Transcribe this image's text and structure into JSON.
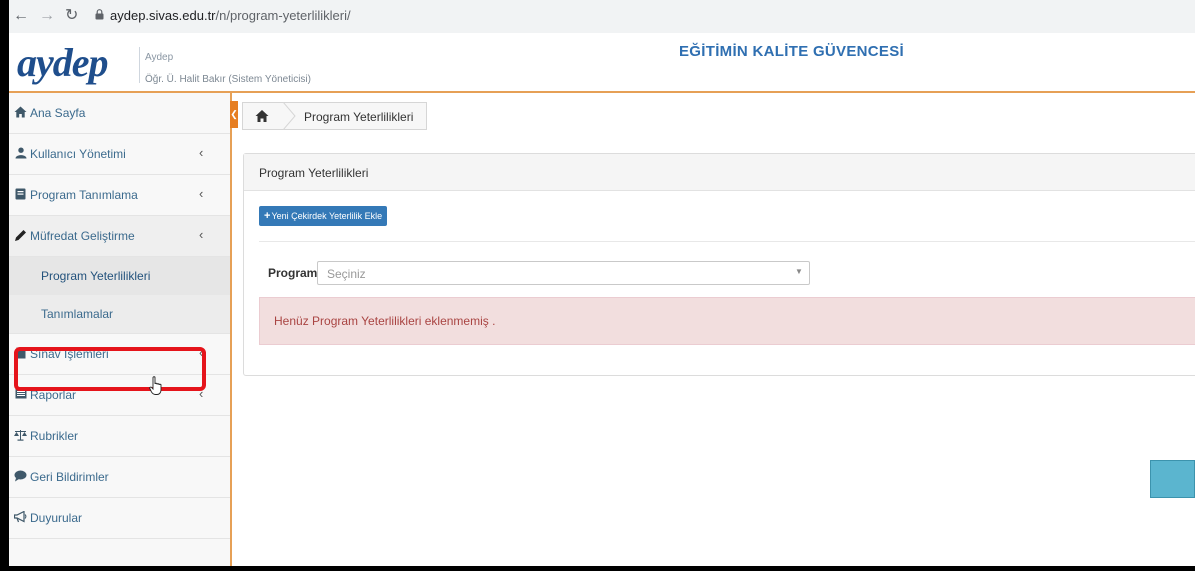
{
  "browser": {
    "url_host": "aydep.sivas.edu.tr",
    "url_path": "/n/program-yeterlilikleri/"
  },
  "header": {
    "logo_text": "aydep",
    "app_name": "Aydep",
    "user": "Öğr. Ü. Halit Bakır (Sistem Yöneticisi)",
    "slogan": "EĞİTİMİN KALİTE GÜVENCESİ"
  },
  "sidebar": {
    "items": [
      {
        "label": "Ana Sayfa",
        "icon": "home-icon"
      },
      {
        "label": "Kullanıcı Yönetimi",
        "icon": "user-icon",
        "chevron": "‹"
      },
      {
        "label": "Program Tanımlama",
        "icon": "book-icon",
        "chevron": "‹"
      },
      {
        "label": "Müfredat Geliştirme",
        "icon": "pencil-icon",
        "chevron": "‹"
      },
      {
        "label": "Sınav İşlemleri",
        "icon": "file-icon",
        "chevron": "‹"
      },
      {
        "label": "Raporlar",
        "icon": "list-icon",
        "chevron": "‹"
      },
      {
        "label": "Rubrikler",
        "icon": "balance-scale-icon"
      },
      {
        "label": "Geri Bildirimler",
        "icon": "comment-icon"
      },
      {
        "label": "Duyurular",
        "icon": "bullhorn-icon"
      }
    ],
    "sub_items": [
      {
        "label": "Program Yeterlilikleri"
      },
      {
        "label": "Tanımlamalar"
      }
    ]
  },
  "breadcrumb": {
    "current": "Program Yeterlilikleri"
  },
  "panel": {
    "title": "Program Yeterlilikleri",
    "add_button": "Yeni Çekirdek Yeterlilik Ekle",
    "program_label": "Program:",
    "program_placeholder": "Seçiniz",
    "alert_text": "Henüz Program Yeterlilikleri eklenmemiş ."
  },
  "colors": {
    "accent_orange": "#e6a056",
    "brand_blue": "#1f4e8c",
    "button_blue": "#3479b7",
    "highlight_red": "#e5141b",
    "alert_bg": "#f2dede"
  }
}
